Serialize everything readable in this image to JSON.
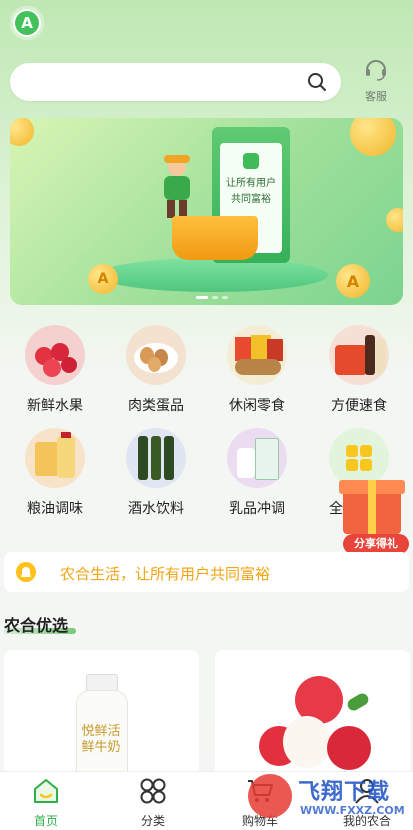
{
  "header": {
    "logo_icon": "brand-logo-icon",
    "search": {
      "placeholder": "",
      "icon": "search-icon"
    },
    "service": {
      "label": "客服",
      "icon": "headset-icon"
    }
  },
  "banner": {
    "slogan_line1": "让所有用户",
    "slogan_line2": "共同富裕",
    "slide_count": 3,
    "active_slide": 1
  },
  "categories": [
    {
      "label": "新鲜水果",
      "icon": "fruit-image",
      "color": "#f4d1cf"
    },
    {
      "label": "肉类蛋品",
      "icon": "eggs-image",
      "color": "#f3e2cf"
    },
    {
      "label": "休闲零食",
      "icon": "snacks-image",
      "color": "#f4edd6"
    },
    {
      "label": "方便速食",
      "icon": "instant-food-image",
      "color": "#f6e0d6"
    },
    {
      "label": "粮油调味",
      "icon": "grain-oil-image",
      "color": "#f7e4c8"
    },
    {
      "label": "酒水饮料",
      "icon": "drinks-image",
      "color": "#dfe6f2"
    },
    {
      "label": "乳品冲调",
      "icon": "dairy-image",
      "color": "#ecdcf1"
    },
    {
      "label": "全",
      "icon": "all-categories-icon",
      "color": "#e2f4dc"
    }
  ],
  "notice": {
    "text": "农合生活，让所有用户共同富裕",
    "icon": "bell-icon"
  },
  "share_gift": {
    "label": "分享得礼"
  },
  "section": {
    "title": "农合优选"
  },
  "products": [
    {
      "name": "milk-product",
      "image_text_1": "悦鲜活",
      "image_text_2": "鲜牛奶"
    },
    {
      "name": "lychee-product"
    }
  ],
  "bottom_nav": [
    {
      "label": "首页",
      "icon": "home-icon",
      "active": true
    },
    {
      "label": "分类",
      "icon": "category-grid-icon",
      "active": false
    },
    {
      "label": "购物车",
      "icon": "cart-icon",
      "active": false
    },
    {
      "label": "我的农合",
      "icon": "user-icon",
      "active": false
    }
  ],
  "watermark": {
    "text1": "飞翔下载",
    "text2": "WWW.FXXZ.COM"
  },
  "colors": {
    "brand_green": "#43c15a",
    "notice_orange": "#f2a413",
    "gift_red": "#e9443a"
  }
}
